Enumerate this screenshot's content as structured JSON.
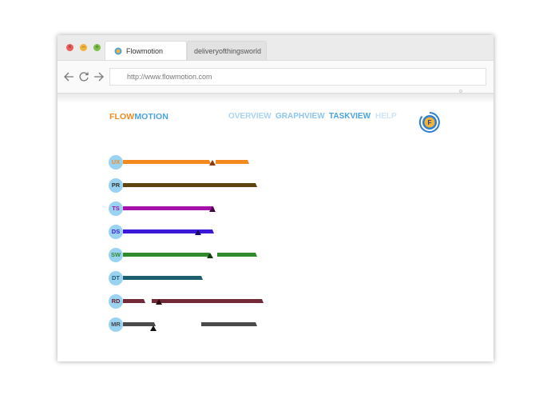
{
  "browser": {
    "tabs": [
      {
        "label": "Flowmotion",
        "active": true
      },
      {
        "label": "deliveryofthingsworld",
        "active": false
      }
    ],
    "url": "http://www.flowmotion.com",
    "window_buttons": [
      "close-button",
      "minimize-button",
      "zoom-button"
    ]
  },
  "app": {
    "logo_part1": "FLOW",
    "logo_part2": "MOTION",
    "nav": [
      "OVERVIEW",
      "GRAPHVIEW",
      "TASKVIEW",
      "HELP"
    ],
    "active_nav": "TASKVIEW",
    "badge_letter": "F"
  },
  "tasks": [
    {
      "code": "UX",
      "label_color": "#f28a1e",
      "color": "#f28a1e"
    },
    {
      "code": "PR",
      "label_color": "#333333",
      "color": "#5e4410"
    },
    {
      "code": "TS",
      "label_color": "#a611a9",
      "color": "#a611a9"
    },
    {
      "code": "DS",
      "label_color": "#3b18d8",
      "color": "#3b18d8"
    },
    {
      "code": "SW",
      "label_color": "#2e8a2c",
      "color": "#2e8a2c"
    },
    {
      "code": "DT",
      "label_color": "#1c5f6e",
      "color": "#1c5f6e"
    },
    {
      "code": "RD",
      "label_color": "#6b1d2e",
      "color": "#722938"
    },
    {
      "code": "MR",
      "label_color": "#444444",
      "color": "#4a4a4a"
    }
  ],
  "colors": {
    "accent": "#4aa3df",
    "logo_orange": "#f28a1e",
    "task_circle": "#9ad2f2"
  }
}
